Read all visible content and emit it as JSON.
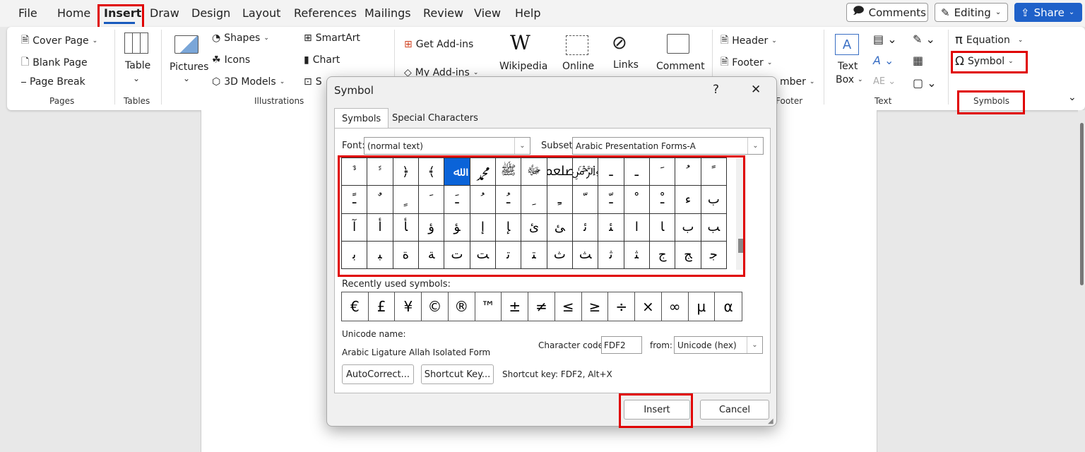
{
  "menu": {
    "tabs": [
      "File",
      "Home",
      "Insert",
      "Draw",
      "Design",
      "Layout",
      "References",
      "Mailings",
      "Review",
      "View",
      "Help"
    ],
    "comments": "Comments",
    "editing": "Editing",
    "share": "Share"
  },
  "ribbon": {
    "pages": {
      "cover_page": "Cover Page",
      "blank_page": "Blank Page",
      "page_break": "Page Break",
      "group": "Pages"
    },
    "tables": {
      "table": "Table",
      "group": "Tables"
    },
    "illustrations": {
      "pictures": "Pictures",
      "shapes": "Shapes",
      "icons": "Icons",
      "models": "3D Models",
      "smartart": "SmartArt",
      "chart": "Chart",
      "screenshot": "S",
      "group": "Illustrations"
    },
    "addins": {
      "get": "Get Add-ins",
      "my": "My Add-ins",
      "wikipedia": "Wikipedia",
      "wiki_glyph": "W"
    },
    "media": {
      "online": "Online"
    },
    "links": {
      "links": "Links"
    },
    "comments": {
      "comment": "Comment"
    },
    "header_footer": {
      "header": "Header",
      "footer": "Footer",
      "page_number": "mber",
      "group": "Footer"
    },
    "text": {
      "text_box_1": "Text",
      "text_box_2": "Box",
      "group": "Text",
      "ae": "AE"
    },
    "symbols": {
      "equation": "Equation",
      "symbol": "Symbol",
      "group": "Symbols"
    }
  },
  "dialog": {
    "title": "Symbol",
    "help": "?",
    "close": "✕",
    "tabs": [
      "Symbols",
      "Special Characters"
    ],
    "font_label": "Font:",
    "font_value": "(normal text)",
    "subset_label": "Subset:",
    "subset_value": "Arabic Presentation Forms-A",
    "symbols": [
      "ﱞ",
      "ﱟ",
      "﴿",
      "﴾",
      "ﷲ",
      "ﷴ",
      "ﷺ",
      "ﷻ",
      "ﷵ",
      "﷽",
      "ـ",
      "ـ",
      "ﹶ",
      "ﹸ",
      "ﹰ",
      "ﹱ",
      "ﹲ",
      "ﹴ",
      "ﹶ",
      "ﹷ",
      "ﹸ",
      "ﹹ",
      "ﹺ",
      "ﹻ",
      "ﹼ",
      "ﹽ",
      "ﹾ",
      "ﹿ",
      "ﺀ",
      "ﺏ",
      "ﺁ",
      "ﺃ",
      "ﺄ",
      "ﺅ",
      "ﺆ",
      "ﺇ",
      "ﺈ",
      "ﺉ",
      "ﺊ",
      "ﺋ",
      "ﺌ",
      "ﺍ",
      "ﺎ",
      "ﺏ",
      "ﺐ",
      "ﺑ",
      "ﺒ",
      "ﺓ",
      "ﺔ",
      "ﺕ",
      "ﺖ",
      "ﺗ",
      "ﺘ",
      "ﺙ",
      "ﺚ",
      "ﺛ",
      "ﺜ",
      "ﺝ",
      "ﺞ",
      "ﺟ"
    ],
    "recent_label": "Recently used symbols:",
    "recent": [
      "€",
      "£",
      "¥",
      "©",
      "®",
      "™",
      "±",
      "≠",
      "≤",
      "≥",
      "÷",
      "×",
      "∞",
      "µ",
      "α"
    ],
    "unicode_name_label": "Unicode name:",
    "unicode_name": "Arabic Ligature Allah Isolated Form",
    "char_code_label": "Character code:",
    "char_code": "FDF2",
    "from_label": "from:",
    "from_value": "Unicode (hex)",
    "autocorrect": "AutoCorrect...",
    "shortcut_key_btn": "Shortcut Key...",
    "shortcut_text": "Shortcut key: FDF2, Alt+X",
    "insert": "Insert",
    "cancel": "Cancel"
  },
  "colors": {
    "accent": "#185abd",
    "highlight": "#e00000",
    "selected": "#0a63d8"
  }
}
